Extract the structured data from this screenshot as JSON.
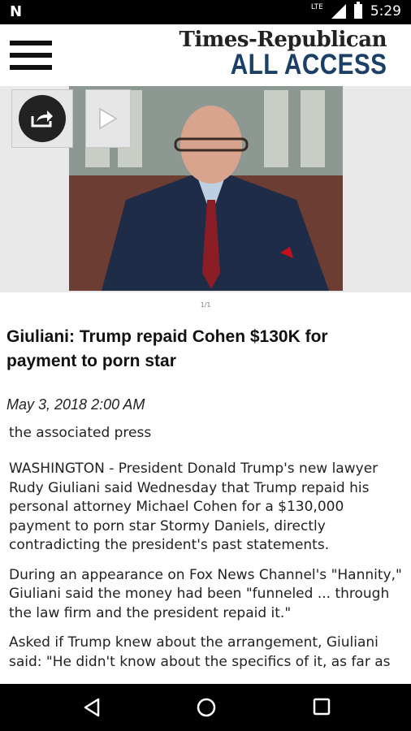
{
  "status_bar": {
    "time": "5:29",
    "network_label": "LTE",
    "icons": [
      "notification-n-icon",
      "lte-icon",
      "signal-icon",
      "battery-icon"
    ]
  },
  "header": {
    "brand_title": "Times-Republican",
    "brand_subtitle": "ALL ACCESS",
    "brand_color": "#1c3f66",
    "menu_icon": "hamburger-menu-icon"
  },
  "media": {
    "share_icon": "share-icon",
    "play_icon": "play-icon",
    "page_indicator": "1/1"
  },
  "article": {
    "headline": "Giuliani: Trump repaid Cohen $130K for payment to porn star",
    "date": "May 3, 2018 2:00 AM",
    "byline": "the associated press",
    "paragraphs": [
      "WASHINGTON - President Donald Trump's new lawyer Rudy Giuliani said Wednesday that Trump repaid his personal attorney Michael Cohen for a $130,000 payment to porn star Stormy Daniels, directly contradicting the president's past statements.",
      "During an appearance on Fox News Channel's \"Hannity,\" Giuliani said the money had been \"funneled ... through the law firm and the president repaid it.\"",
      "Asked if Trump knew about the arrangement, Giuliani said: \"He didn't know about the specifics of it, as far as"
    ]
  },
  "nav_bar": {
    "icons": [
      "back-icon",
      "home-icon",
      "recents-icon"
    ]
  }
}
